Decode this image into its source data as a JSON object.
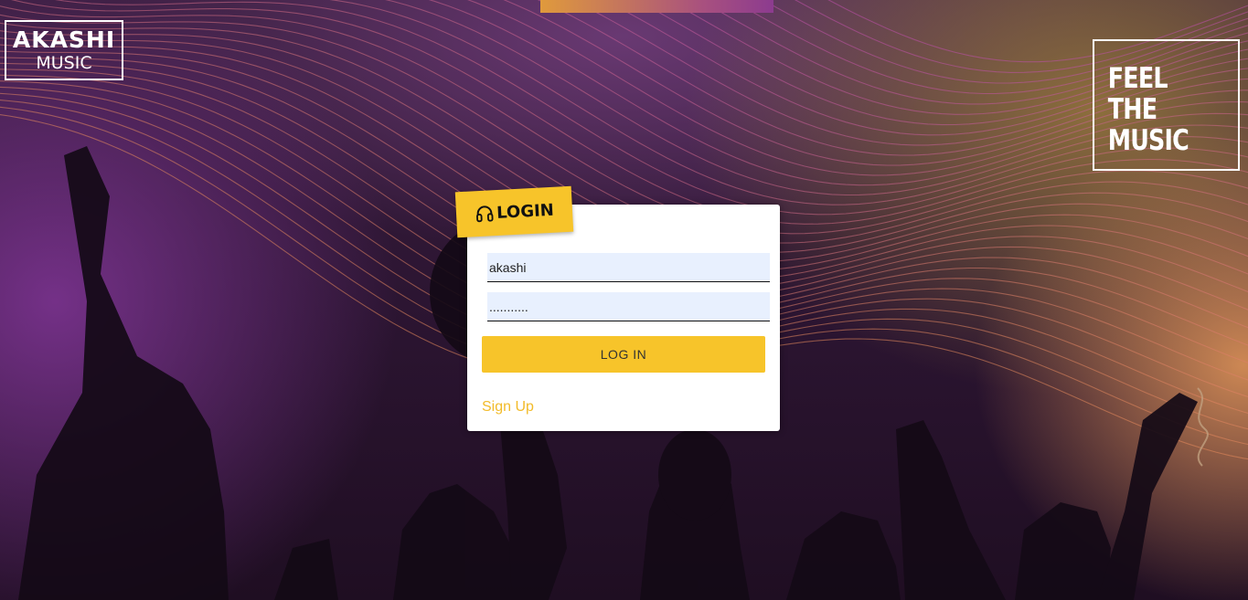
{
  "brand": {
    "title": "AKASHI",
    "subtitle": "MUSIC"
  },
  "tagline": [
    "FEEL",
    "THE",
    "MUSIC"
  ],
  "login": {
    "heading": "LOGIN",
    "icon": "headphones-icon",
    "username_value": "akashi",
    "password_value": "...........",
    "submit_label": "LOG IN",
    "signup_label": "Sign Up"
  },
  "colors": {
    "accent": "#f7c42a",
    "link": "#f2bb2a",
    "input_bg": "#e8f0fe"
  }
}
